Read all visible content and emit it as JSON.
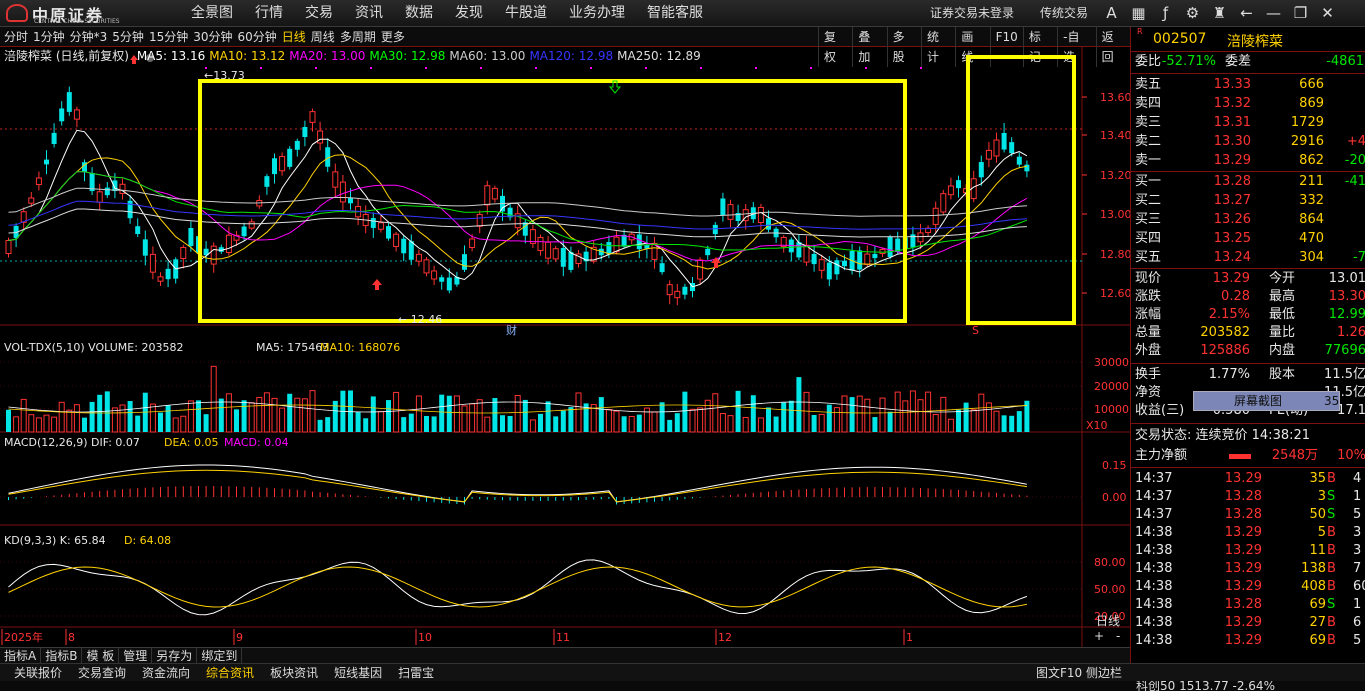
{
  "topbar": {
    "logo_main": "中原证券",
    "logo_sub": "CENTRAL CHINA SECURITIES",
    "menu": [
      "全景图",
      "行情",
      "交易",
      "资讯",
      "数据",
      "发现",
      "牛股道",
      "业务办理",
      "智能客服"
    ],
    "status": "证券交易未登录",
    "mode": "传统交易",
    "icons": [
      "font-size-icon",
      "grid-icon",
      "fx-icon",
      "gear-icon",
      "tshirt-icon",
      "back-arrow-icon",
      "minimize-icon",
      "restore-icon",
      "close-icon"
    ]
  },
  "toolbar": {
    "periods": [
      "分时",
      "1分钟",
      "分钟*3",
      "5分钟",
      "15分钟",
      "30分钟",
      "60分钟",
      "日线",
      "周线",
      "多周期",
      "更多"
    ],
    "active": "日线",
    "tools": [
      "复权",
      "叠加",
      "多股",
      "统计",
      "画线",
      "F10",
      "标记",
      "-自选",
      "返回"
    ]
  },
  "main": {
    "stock_label": "涪陵榨菜 (日线,前复权)",
    "ma": [
      {
        "label": "MA5: 13.16",
        "color": "#ffffff"
      },
      {
        "label": "MA10: 13.12",
        "color": "#ffd200"
      },
      {
        "label": "MA20: 13.00",
        "color": "#ff00ff"
      },
      {
        "label": "MA30: 12.98",
        "color": "#00ff00"
      },
      {
        "label": "MA60: 13.00",
        "color": "#cccccc"
      },
      {
        "label": "MA120: 12.98",
        "color": "#3535ff"
      },
      {
        "label": "MA250: 12.89",
        "color": "#dddddd"
      }
    ],
    "high_label": "13.73",
    "low_label": "12.46",
    "event_label": "财",
    "ylabels": [
      "13.60",
      "13.40",
      "13.20",
      "13.00",
      "12.80",
      "12.60"
    ],
    "date_axis": [
      "2025年",
      "8",
      "9",
      "10",
      "11",
      "12",
      "1"
    ],
    "mark_s": "S"
  },
  "volume": {
    "title": "VOL-TDX(5,10)",
    "vol": "VOLUME: 203582",
    "ma5": "MA5: 175463",
    "ma10": "MA10: 168076",
    "ylabels": [
      "30000",
      "20000",
      "10000"
    ],
    "unit": "X10"
  },
  "macd": {
    "title": "MACD(12,26,9)",
    "dif": "DIF: 0.07",
    "dea": "DEA: 0.05",
    "macd": "MACD: 0.04",
    "ylabels": [
      "0.15",
      "0.00"
    ]
  },
  "kd": {
    "title": "KD(9,3,3)",
    "k": "K: 65.84",
    "d": "D: 64.08",
    "ylabels": [
      "80.00",
      "50.00",
      "20.00"
    ]
  },
  "chart_period_tag": "日线",
  "right": {
    "code": "002507",
    "name": "涪陵榨菜",
    "badge": "R",
    "weibi_label": "委比",
    "weibi": "-52.71%",
    "weicha_label": "委差",
    "weicha": "-4861",
    "asks": [
      {
        "l": "卖五",
        "p": "13.33",
        "v": "666",
        "d": ""
      },
      {
        "l": "卖四",
        "p": "13.32",
        "v": "869",
        "d": ""
      },
      {
        "l": "卖三",
        "p": "13.31",
        "v": "1729",
        "d": ""
      },
      {
        "l": "卖二",
        "p": "13.30",
        "v": "2916",
        "d": "+4"
      },
      {
        "l": "卖一",
        "p": "13.29",
        "v": "862",
        "d": "-20"
      }
    ],
    "bids": [
      {
        "l": "买一",
        "p": "13.28",
        "v": "211",
        "d": "-41"
      },
      {
        "l": "买二",
        "p": "13.27",
        "v": "332",
        "d": ""
      },
      {
        "l": "买三",
        "p": "13.26",
        "v": "864",
        "d": ""
      },
      {
        "l": "买四",
        "p": "13.25",
        "v": "470",
        "d": ""
      },
      {
        "l": "买五",
        "p": "13.24",
        "v": "304",
        "d": "-7"
      }
    ],
    "quote": [
      {
        "a": "现价",
        "av": "13.29",
        "b": "今开",
        "bv": "13.01"
      },
      {
        "a": "涨跌",
        "av": "0.28",
        "b": "最高",
        "bv": "13.30"
      },
      {
        "a": "涨幅",
        "av": "2.15%",
        "b": "最低",
        "bv": "12.99"
      },
      {
        "a": "总量",
        "av": "203582",
        "b": "量比",
        "bv": "1.26"
      },
      {
        "a": "外盘",
        "av": "125886",
        "b": "内盘",
        "bv": "77696"
      }
    ],
    "stats": [
      {
        "a": "换手",
        "av": "1.77%",
        "b": "股本",
        "bv": "11.5亿"
      },
      {
        "a": "净资",
        "av": "",
        "b": "",
        "bv": "11.5亿"
      },
      {
        "a": "收益(三)",
        "av": "0.580",
        "b": "PE(动)",
        "bv": "17.1"
      }
    ],
    "popup_label": "屏幕截图",
    "popup_num": "35",
    "trade_status": "交易状态: 连续竞价 14:38:21",
    "mainflow_label": "主力净额",
    "mainflow": "2548万",
    "mainflow_pct": "10%",
    "ticks": [
      {
        "t": "14:37",
        "p": "13.29",
        "v": "35",
        "bs": "B",
        "x": "4"
      },
      {
        "t": "14:37",
        "p": "13.28",
        "v": "3",
        "bs": "S",
        "x": "1"
      },
      {
        "t": "14:37",
        "p": "13.28",
        "v": "50",
        "bs": "S",
        "x": "5"
      },
      {
        "t": "14:38",
        "p": "13.29",
        "v": "5",
        "bs": "B",
        "x": "3"
      },
      {
        "t": "14:38",
        "p": "13.29",
        "v": "11",
        "bs": "B",
        "x": "3"
      },
      {
        "t": "14:38",
        "p": "13.29",
        "v": "138",
        "bs": "B",
        "x": "7"
      },
      {
        "t": "14:38",
        "p": "13.29",
        "v": "408",
        "bs": "B",
        "x": "60"
      },
      {
        "t": "14:38",
        "p": "13.28",
        "v": "69",
        "bs": "S",
        "x": "1"
      },
      {
        "t": "14:38",
        "p": "13.29",
        "v": "27",
        "bs": "B",
        "x": "6"
      },
      {
        "t": "14:38",
        "p": "13.29",
        "v": "69",
        "bs": "B",
        "x": "5"
      }
    ]
  },
  "bottom": {
    "tabs1": [
      "指标A",
      "指标B",
      "模 板",
      "管理",
      "另存为",
      "绑定到"
    ],
    "tabs2": [
      "关联报价",
      "交易查询",
      "资金流向",
      "综合资讯",
      "板块资讯",
      "短线基因",
      "扫雷宝"
    ],
    "active_tab2": "综合资讯",
    "right_text": "图文F10  侧边栏",
    "index": "科创50  1513.77  -2.64%"
  }
}
